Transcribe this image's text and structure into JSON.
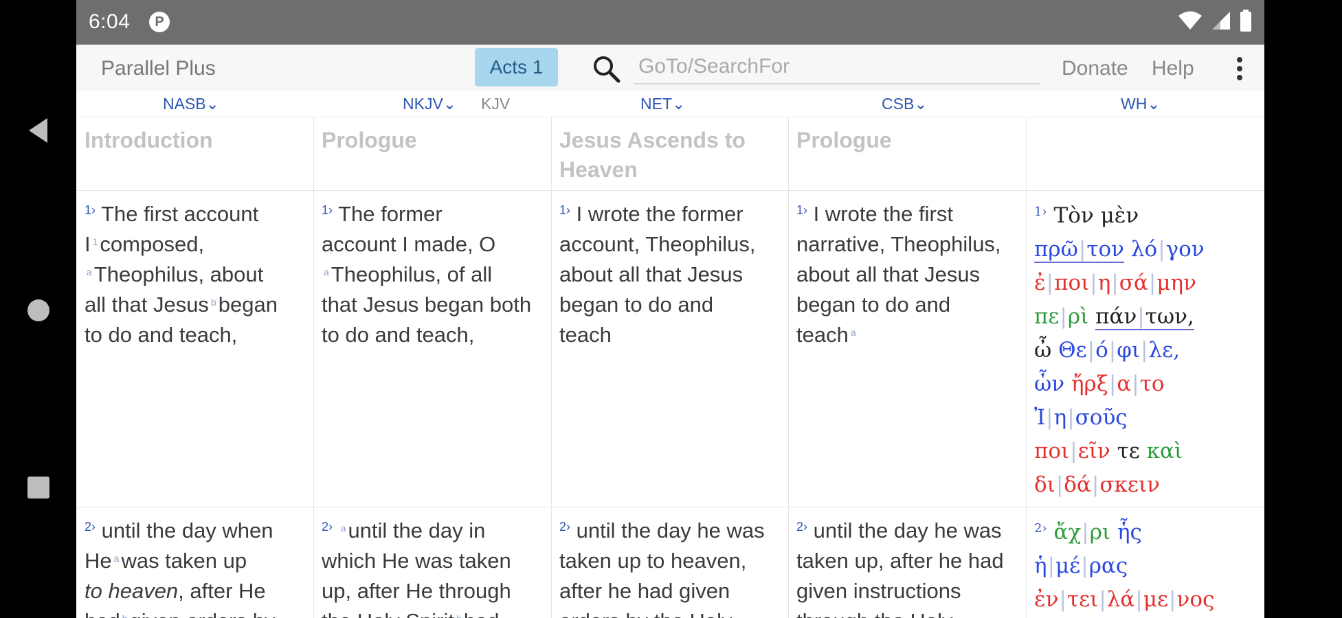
{
  "status": {
    "time": "6:04",
    "badge": "P"
  },
  "app": {
    "title": "Parallel Plus",
    "book_button": "Acts 1",
    "search_placeholder": "GoTo/SearchFor",
    "donate": "Donate",
    "help": "Help"
  },
  "columns": [
    {
      "version": "NASB",
      "heading": "Introduction"
    },
    {
      "version": "NKJV",
      "version_alt": "KJV",
      "heading": "Prologue"
    },
    {
      "version": "NET",
      "heading": "Jesus Ascends to Heaven"
    },
    {
      "version": "CSB",
      "heading": "Prologue"
    },
    {
      "version": "WH",
      "heading": ""
    }
  ],
  "verse1": {
    "num": "1",
    "nasb": [
      "The first account",
      "composed,",
      "Theophilus, about",
      "all that Jesus",
      "began",
      "to do and teach,"
    ],
    "nasb_fn": [
      "1",
      "a",
      "b"
    ],
    "nkjv": [
      "The former",
      "account I made, O",
      "Theophilus, of all",
      "that Jesus began both",
      "to do and teach,"
    ],
    "nkjv_fn": "a",
    "net": [
      "I wrote the former",
      "account, Theophilus,",
      "about all that Jesus",
      "began to do and",
      "teach"
    ],
    "csb": [
      "I wrote the first",
      "narrative, Theophilus,",
      "about all that Jesus",
      "began to do and",
      "teach"
    ],
    "csb_fn": "a"
  },
  "verse2": {
    "num": "2",
    "nasb": [
      "until the day when",
      "He",
      "was taken up",
      "to heaven",
      ", after He",
      "had",
      "given orders by"
    ],
    "nasb_fn": [
      "a",
      "b"
    ],
    "nkjv": [
      "until the day in",
      "which He was taken",
      "up, after He through",
      "the Holy Spirit",
      "had"
    ],
    "nkjv_fn": [
      "a",
      "b"
    ],
    "net": [
      "until the day he was",
      "taken up to heaven,",
      "after he had given",
      "orders by the Holy"
    ],
    "csb": [
      "until the day he was",
      "taken up, after he had",
      "given instructions",
      "through the Holy"
    ]
  },
  "greek": {
    "v1": [
      [
        [
          "Τὸν",
          "black"
        ],
        [
          "μὲν",
          "black"
        ]
      ],
      [
        [
          "πρῶ|τον",
          "blue-ul"
        ],
        [
          "λό|γον",
          "blue"
        ]
      ],
      [
        [
          "ἐ|ποι|η|σά|μην",
          "red"
        ]
      ],
      [
        [
          "πε|ρὶ",
          "green"
        ],
        [
          "πάν|των,",
          "black-ul"
        ]
      ],
      [
        [
          "ὦ",
          "black"
        ],
        [
          "Θε|ό|φι|λε,",
          "blue"
        ]
      ],
      [
        [
          "ὧν",
          "blue"
        ],
        [
          "ἤρξ|α|το",
          "red"
        ]
      ],
      [
        [
          "Ἰ|η|σοῦς",
          "blue"
        ]
      ],
      [
        [
          "ποι|εῖν",
          "red"
        ],
        [
          "τε",
          "black"
        ],
        [
          "καὶ",
          "green"
        ]
      ],
      [
        [
          "δι|δά|σκειν",
          "red"
        ]
      ]
    ],
    "v2": [
      [
        [
          "ἄχ|ρι",
          "green"
        ],
        [
          "ἧς",
          "blue"
        ]
      ],
      [
        [
          "ἡ|μέ|ρας",
          "blue"
        ]
      ],
      [
        [
          "ἐν|τει|λά|με|νος",
          "red"
        ]
      ]
    ]
  }
}
